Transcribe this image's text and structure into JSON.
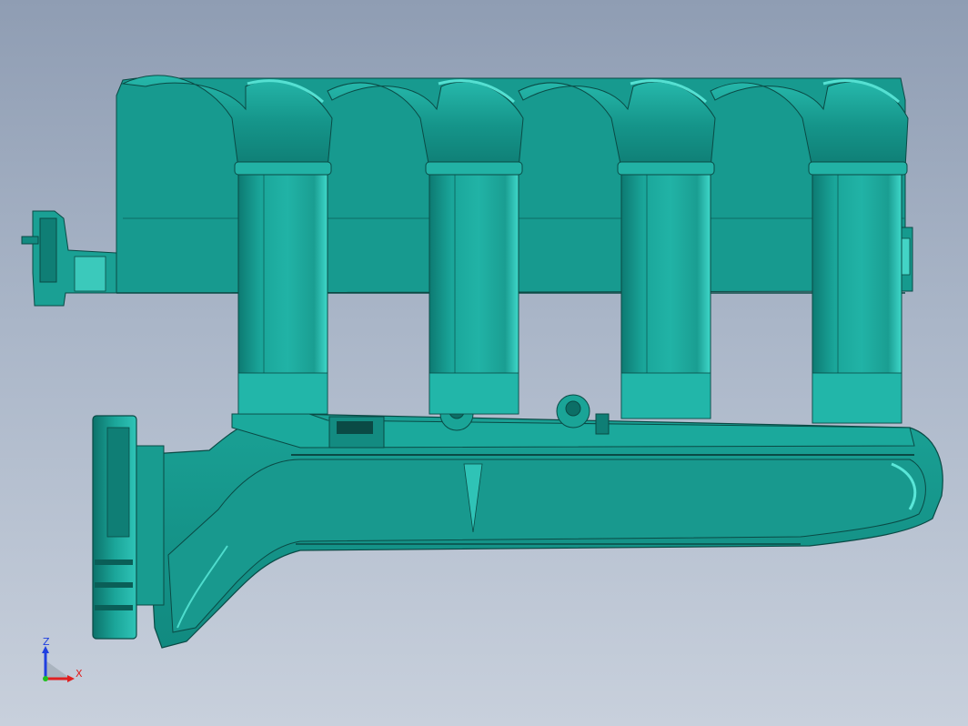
{
  "colors": {
    "background_top": "#8f9db3",
    "background_bottom": "#c8d0dc",
    "model_fill": "#1a9e92",
    "model_dark": "#0c6f67",
    "model_light": "#3fd0c2",
    "edge": "#0a4a45",
    "axis_x": "#e02020",
    "axis_y": "#20c020",
    "axis_z": "#2040e0"
  },
  "model": {
    "name": "intake-manifest-model"
  },
  "triad": {
    "z_label": "Z",
    "x_label": "X"
  }
}
